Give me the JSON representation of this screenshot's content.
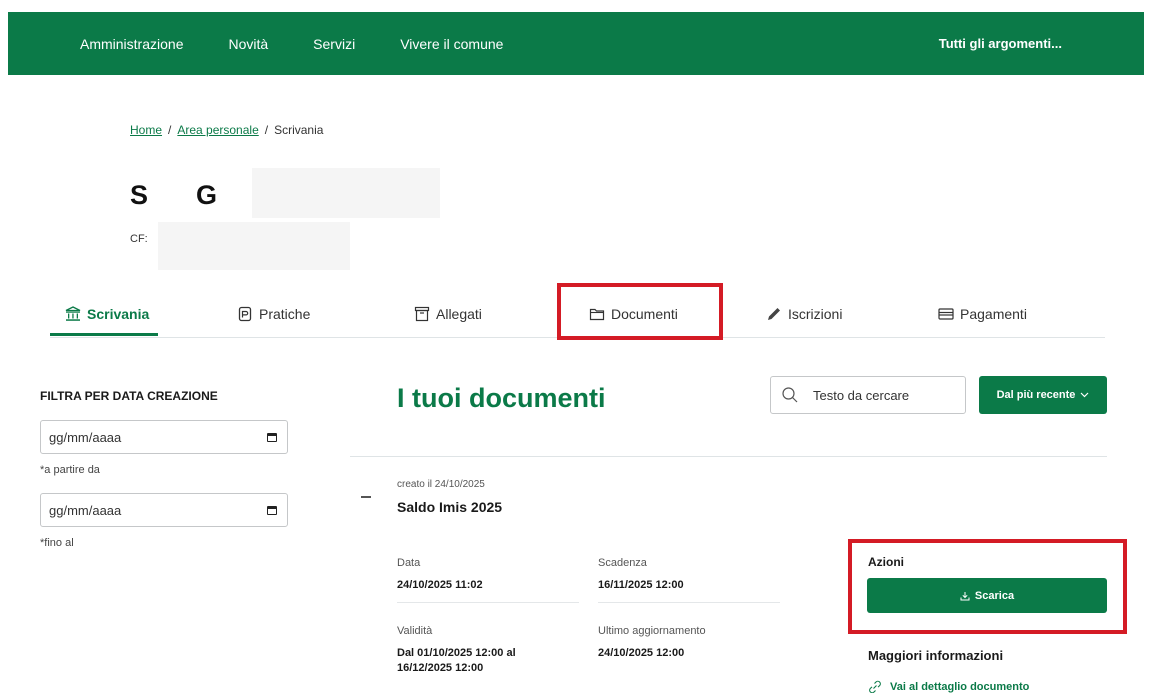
{
  "topnav": {
    "items": [
      "Amministrazione",
      "Novità",
      "Servizi",
      "Vivere il comune"
    ],
    "topics": "Tutti gli argomenti..."
  },
  "breadcrumb": {
    "home": "Home",
    "area": "Area personale",
    "current": "Scrivania",
    "separator": "/"
  },
  "user": {
    "initial1": "S",
    "initial2": "G",
    "cf_label": "CF:"
  },
  "tabs": [
    {
      "label": "Scrivania",
      "icon": "bank-icon"
    },
    {
      "label": "Pratiche",
      "icon": "document-icon"
    },
    {
      "label": "Allegati",
      "icon": "archive-icon"
    },
    {
      "label": "Documenti",
      "icon": "folder-icon"
    },
    {
      "label": "Iscrizioni",
      "icon": "pencil-icon"
    },
    {
      "label": "Pagamenti",
      "icon": "card-icon"
    }
  ],
  "filter": {
    "title": "FILTRA PER DATA CREAZIONE",
    "from_placeholder": "gg/mm/aaaa",
    "from_hint": "*a partire da",
    "to_placeholder": "gg/mm/aaaa",
    "to_hint": "*fino al"
  },
  "main": {
    "title": "I tuoi documenti",
    "search_placeholder": "Testo da cercare",
    "sort_label": "Dal più recente"
  },
  "document": {
    "created": "creato il 24/10/2025",
    "title": "Saldo Imis 2025",
    "data_label": "Data",
    "data_value": "24/10/2025 11:02",
    "scadenza_label": "Scadenza",
    "scadenza_value": "16/11/2025 12:00",
    "validita_label": "Validità",
    "validita_value_1": "Dal 01/10/2025 12:00 al",
    "validita_value_2": "16/12/2025 12:00",
    "aggiornamento_label": "Ultimo aggiornamento",
    "aggiornamento_value": "24/10/2025 12:00"
  },
  "actions": {
    "label": "Azioni",
    "download": "Scarica",
    "more_info": "Maggiori informazioni",
    "detail_link": "Vai al dettaglio documento"
  },
  "colors": {
    "brand_green": "#0b7a48",
    "highlight_red": "#d41b25"
  }
}
